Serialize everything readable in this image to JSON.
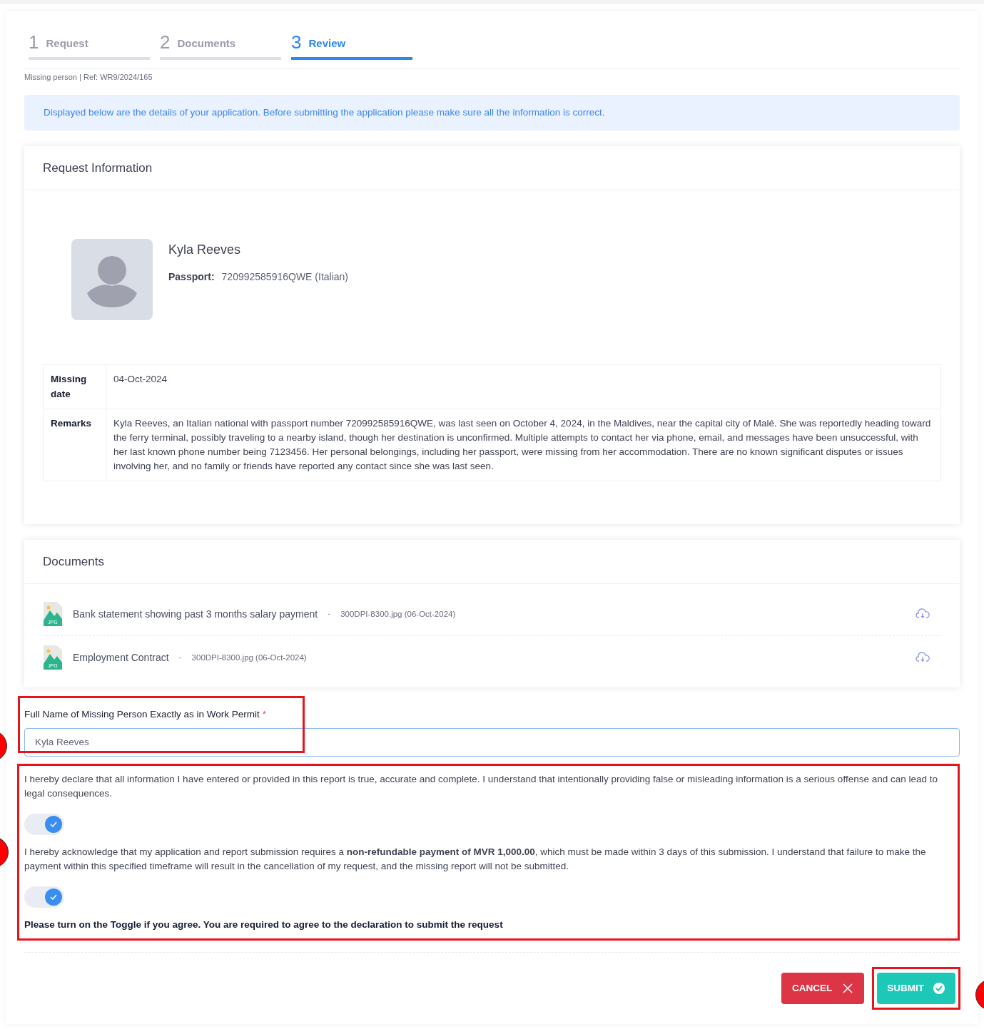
{
  "steps": [
    {
      "number": "1",
      "label": "Request",
      "selected": false
    },
    {
      "number": "2",
      "label": "Documents",
      "selected": false
    },
    {
      "number": "3",
      "label": "Review",
      "selected": true
    }
  ],
  "reference": "Missing person | Ref: WR9/2024/165",
  "notice": "Displayed below are the details of your application. Before submitting the application please make sure all the information is correct.",
  "request_information": {
    "title": "Request Information",
    "name": "Kyla Reeves",
    "passport_label": "Passport:",
    "passport_value": "720992585916QWE (Italian)",
    "rows": [
      {
        "label": "Missing date",
        "value": "04-Oct-2024"
      },
      {
        "label": "Remarks",
        "value": "Kyla Reeves, an Italian national with passport number 720992585916QWE, was last seen on October 4, 2024, in the Maldives, near the capital city of Malé. She was reportedly heading toward the ferry terminal, possibly traveling to a nearby island, though her destination is unconfirmed. Multiple attempts to contact her via phone, email, and messages have been unsuccessful, with her last known phone number being 7123456. Her personal belongings, including her passport, were missing from her accommodation. There are no known significant disputes or issues involving her, and no family or friends have reported any contact since she was last seen."
      }
    ]
  },
  "documents": {
    "title": "Documents",
    "items": [
      {
        "name": "Bank statement showing past 3 months salary payment",
        "separator": "-",
        "file": "300DPI-8300.jpg (06-Oct-2024)",
        "badge": "JPG"
      },
      {
        "name": "Employment Contract",
        "separator": "-",
        "file": "300DPI-8300.jpg (06-Oct-2024)",
        "badge": "JPG"
      }
    ]
  },
  "full_name_field": {
    "label": "Full Name of Missing Person Exactly as in Work Permit",
    "required_mark": "*",
    "value": "Kyla Reeves"
  },
  "declarations": [
    {
      "text": "I hereby declare that all information I have entered or provided in this report is true, accurate and complete. I understand that intentionally providing false or misleading information is a serious offense and can lead to legal consequences.",
      "on": true
    },
    {
      "text": "I hereby acknowledge that my application and report submission requires a **non-refundable payment of MVR 1,000.00**, which must be made within 3 days of this submission. I understand that failure to make the payment within this specified timeframe will result in the cancellation of my request, and the missing report will not be submitted.",
      "on": true
    }
  ],
  "agreement_note": "Please turn on the Toggle if you agree. You are required to agree to the declaration to submit the request",
  "buttons": {
    "cancel": "CANCEL",
    "submit": "SUBMIT"
  }
}
